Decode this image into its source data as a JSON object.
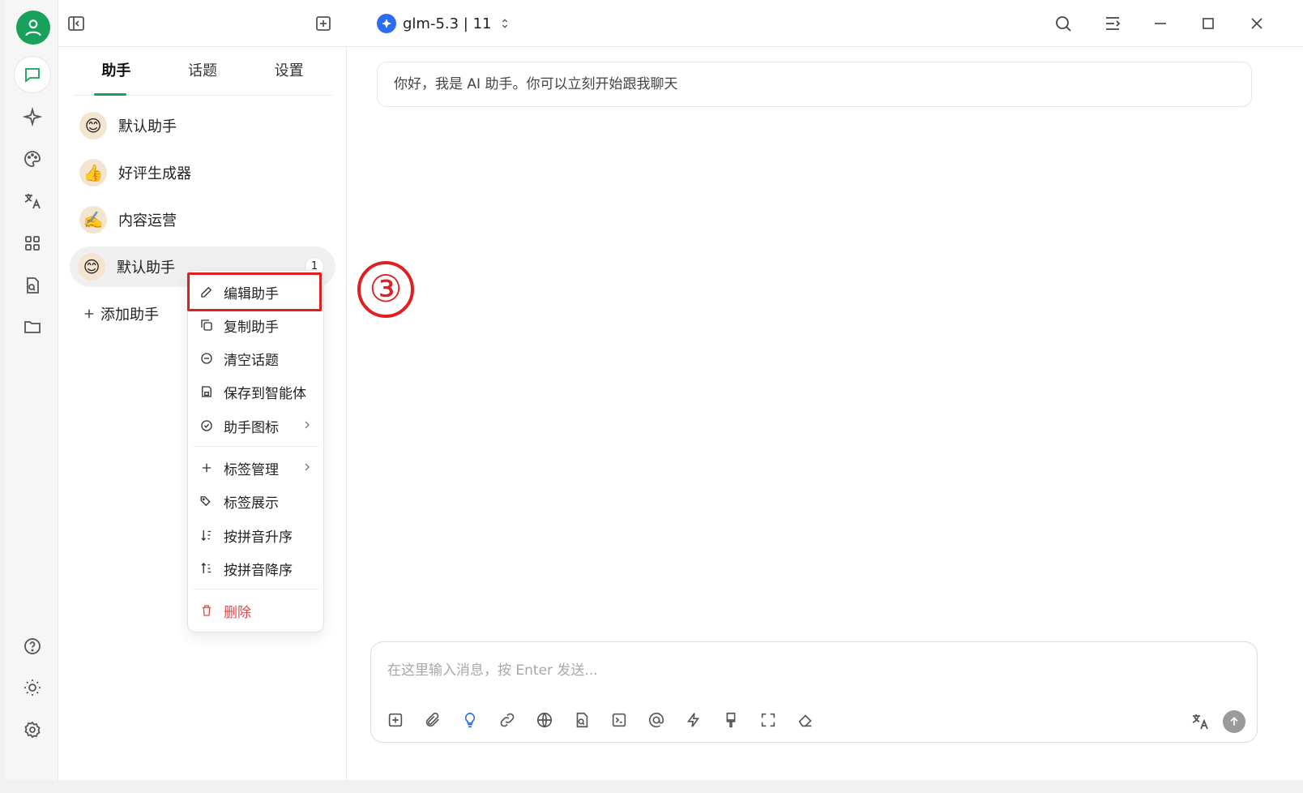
{
  "topbar": {
    "model_label": "glm-5.3 | 11",
    "icons": [
      "sidebar-toggle-icon",
      "new-topic-icon",
      "search-icon",
      "layout-icon",
      "minimize-icon",
      "maximize-icon",
      "close-icon"
    ]
  },
  "panel": {
    "tabs": [
      "助手",
      "话题",
      "设置"
    ],
    "active_tab": "助手",
    "assistants": [
      {
        "name": "默认助手",
        "emoji": "😊"
      },
      {
        "name": "好评生成器",
        "emoji": "👍"
      },
      {
        "name": "内容运营",
        "emoji": "✍️"
      },
      {
        "name": "默认助手",
        "emoji": "😊",
        "badge": "1",
        "selected": true
      }
    ],
    "add_label": "添加助手"
  },
  "context_menu": {
    "items": [
      {
        "label": "编辑助手",
        "icon": "pencil-icon"
      },
      {
        "label": "复制助手",
        "icon": "copy-icon"
      },
      {
        "label": "清空话题",
        "icon": "minus-circle-icon"
      },
      {
        "label": "保存到智能体",
        "icon": "save-icon"
      },
      {
        "label": "助手图标",
        "icon": "check-circle-icon",
        "submenu": true
      },
      {
        "label": "标签管理",
        "icon": "plus-icon",
        "submenu": true
      },
      {
        "label": "标签展示",
        "icon": "tags-icon"
      },
      {
        "label": "按拼音升序",
        "icon": "sort-asc-icon"
      },
      {
        "label": "按拼音降序",
        "icon": "sort-desc-icon"
      },
      {
        "label": "删除",
        "icon": "trash-icon",
        "danger": true
      }
    ],
    "highlighted": "编辑助手"
  },
  "annotation": {
    "step": "③",
    "color": "#e02020"
  },
  "chat": {
    "welcome": "你好，我是 AI 助手。你可以立刻开始跟我聊天",
    "input_placeholder": "在这里输入消息，按 Enter 发送..."
  },
  "colors": {
    "accent": "#17a15a",
    "danger": "#e5484d",
    "model_logo": "#2b6cf0"
  }
}
